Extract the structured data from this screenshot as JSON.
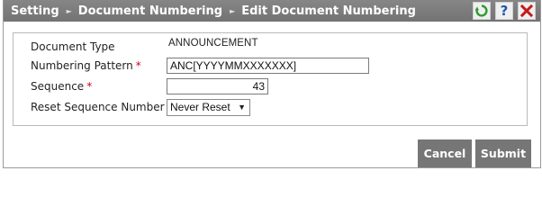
{
  "breadcrumb": {
    "items": [
      "Setting",
      "Document Numbering",
      "Edit Document Numbering"
    ],
    "separator": "►"
  },
  "toolbar": {
    "refresh_icon": "refresh-icon",
    "help_icon": "help-icon",
    "close_icon": "close-icon",
    "help_glyph": "?",
    "colors": {
      "refresh": "#2e9a2e",
      "help": "#2355b0",
      "close": "#c41a1a"
    }
  },
  "form": {
    "document_type": {
      "label": "Document Type",
      "value": "ANNOUNCEMENT"
    },
    "numbering_pattern": {
      "label": "Numbering Pattern",
      "required_mark": "*",
      "value": "ANC[YYYYMMXXXXXXX]"
    },
    "sequence": {
      "label": "Sequence",
      "required_mark": "*",
      "value": "43"
    },
    "reset_sequence": {
      "label": "Reset Sequence Number",
      "selected": "Never Reset",
      "arrow": "▼"
    }
  },
  "actions": {
    "cancel_label": "Cancel",
    "submit_label": "Submit"
  }
}
